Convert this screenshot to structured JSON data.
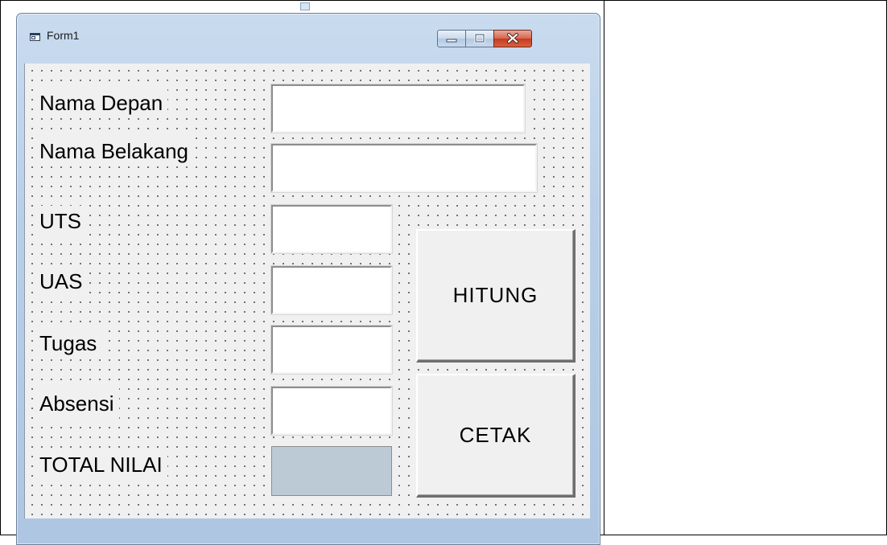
{
  "window": {
    "title": "Form1",
    "minimize_label": "Minimize",
    "maximize_label": "Maximize",
    "close_label": "Close"
  },
  "labels": {
    "nama_depan": "Nama Depan",
    "nama_belakang": "Nama Belakang",
    "uts": "UTS",
    "uas": "UAS",
    "tugas": "Tugas",
    "absensi": "Absensi",
    "total_nilai": "TOTAL NILAI"
  },
  "inputs": {
    "nama_depan": "",
    "nama_belakang": "",
    "uts": "",
    "uas": "",
    "tugas": "",
    "absensi": "",
    "total_nilai": ""
  },
  "buttons": {
    "hitung": "HITUNG",
    "cetak": "CETAK"
  },
  "icons": {
    "app": "form-icon",
    "minimize": "minimize-icon",
    "maximize": "maximize-icon",
    "close": "close-icon"
  },
  "colors": {
    "titlebar": "#b9cfe7",
    "close_button": "#c73a1f",
    "client_background": "#f0f0f0",
    "total_field": "#bccad6"
  }
}
